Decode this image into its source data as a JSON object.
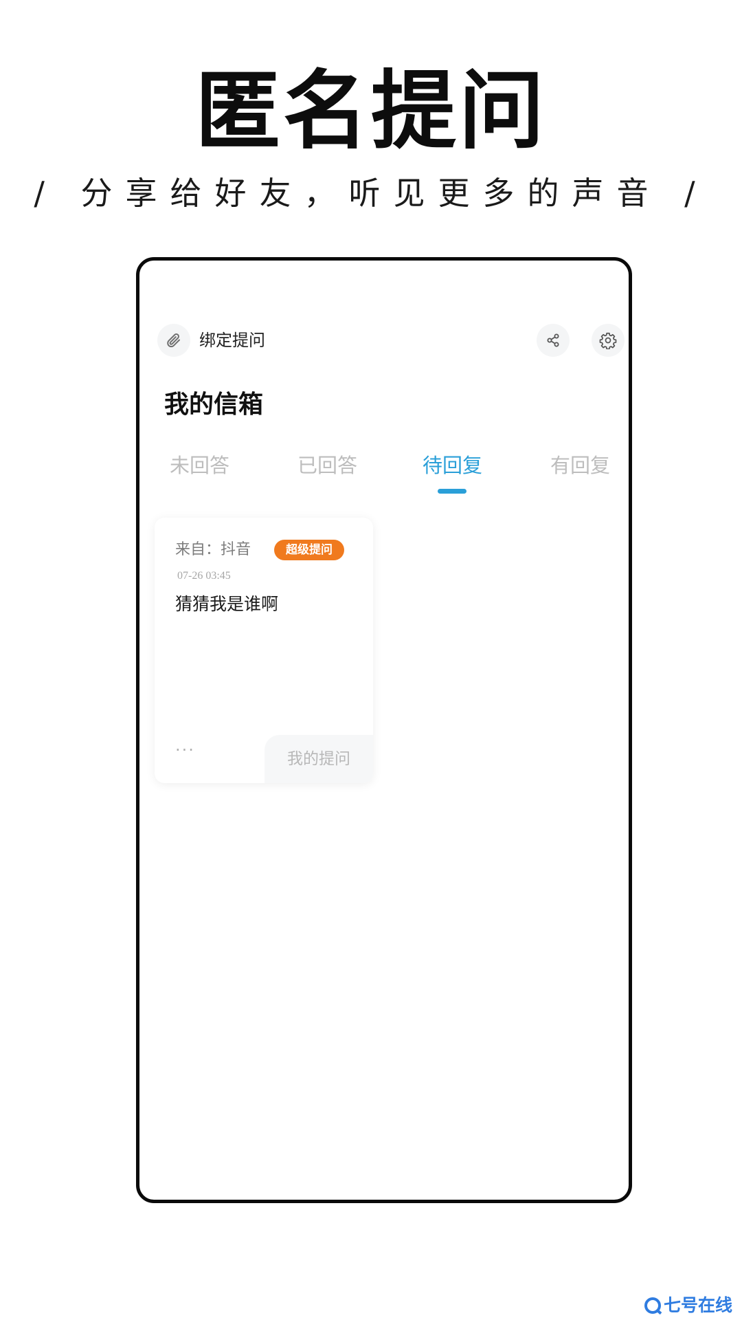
{
  "promo": {
    "title": "匿名提问",
    "subtitle": "/ 分享给好友，听见更多的声音 /"
  },
  "header": {
    "bind_label": "绑定提问",
    "bind_icon": "paperclip-icon",
    "share_icon": "share-icon",
    "settings_icon": "gear-icon"
  },
  "inbox": {
    "title": "我的信箱"
  },
  "tabs": [
    {
      "label": "未回答",
      "active": false
    },
    {
      "label": "已回答",
      "active": false
    },
    {
      "label": "待回复",
      "active": true
    },
    {
      "label": "有回复",
      "active": false
    }
  ],
  "card": {
    "source": "来自：抖音",
    "badge": "超级提问",
    "time": "07-26 03:45",
    "question": "猜猜我是谁啊",
    "more": "···",
    "my_question": "我的提问"
  },
  "watermark": {
    "text": "七号在线"
  },
  "colors": {
    "accent": "#2a9fd8",
    "badge": "#f07a1e",
    "inactive_tab": "#bdbdbd",
    "watermark": "#2f7ce0"
  }
}
